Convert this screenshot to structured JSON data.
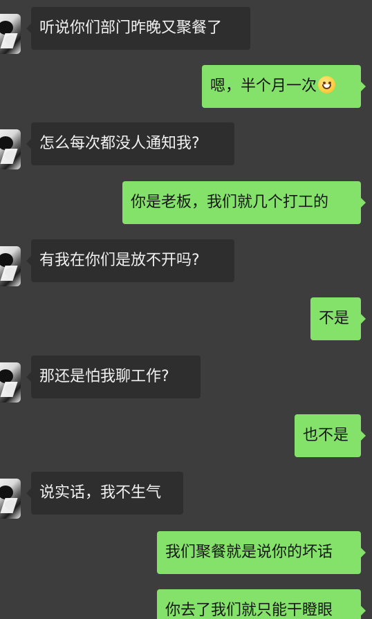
{
  "messages": [
    {
      "side": "left",
      "text": "听说你们部门昨晚又聚餐了"
    },
    {
      "side": "right",
      "text": "嗯，半个月一次",
      "emoji": "grinning-face-emoji"
    },
    {
      "side": "left",
      "text": "怎么每次都没人通知我?"
    },
    {
      "side": "right",
      "text": "你是老板，我们就几个打工的"
    },
    {
      "side": "left",
      "text": "有我在你们是放不开吗?"
    },
    {
      "side": "right",
      "text": "不是"
    },
    {
      "side": "left",
      "text": "那还是怕我聊工作?"
    },
    {
      "side": "right",
      "text": "也不是"
    },
    {
      "side": "left",
      "text": "说实话，我不生气"
    },
    {
      "side": "right",
      "text": "我们聚餐就是说你的坏话"
    },
    {
      "side": "right",
      "text": "你去了我们就只能干瞪眼"
    }
  ],
  "colors": {
    "background": "#3d3d3d",
    "incoming_bubble": "#2e2e2e",
    "outgoing_bubble": "#84e16a"
  }
}
